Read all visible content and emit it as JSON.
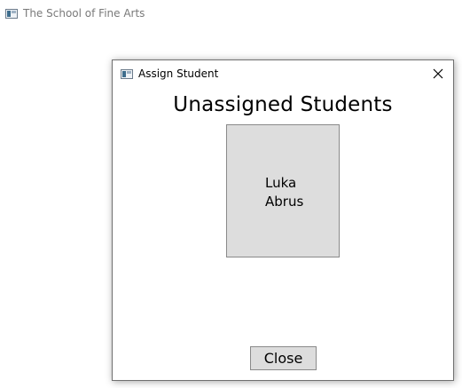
{
  "app": {
    "title": "The School of Fine Arts",
    "icon": "window-icon"
  },
  "dialog": {
    "title": "Assign Student",
    "icon": "window-icon",
    "close_icon": "close-icon",
    "heading": "Unassigned Students",
    "students": [
      {
        "first_name": "Luka",
        "last_name": "Abrus"
      }
    ],
    "close_label": "Close"
  }
}
